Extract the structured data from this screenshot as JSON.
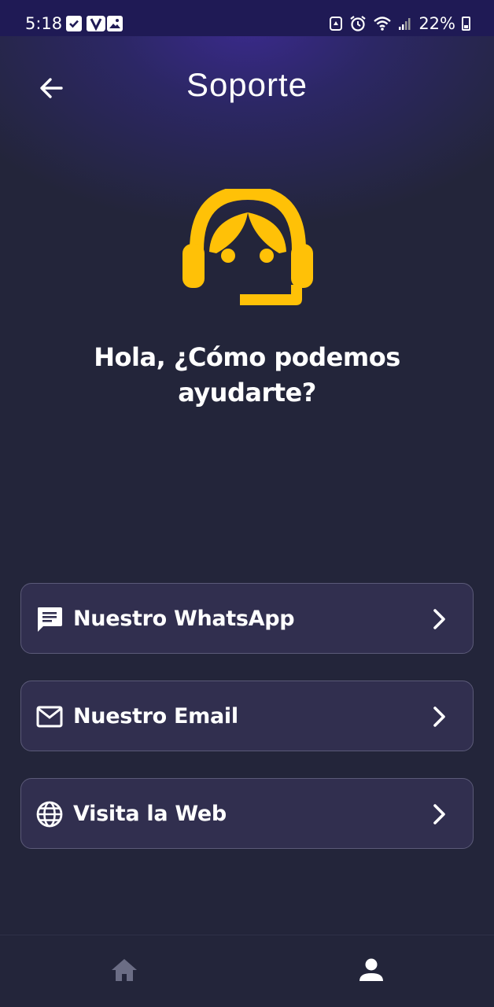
{
  "status_bar": {
    "time": "5:18",
    "battery": "22%",
    "left_icons": [
      "check-box-icon",
      "v-app-icon",
      "image-icon"
    ],
    "right_icons": [
      "recycle-icon",
      "alarm-icon",
      "wifi-icon",
      "signal-icon",
      "battery-icon"
    ]
  },
  "header": {
    "title": "Soporte",
    "back_icon": "arrow-left-icon"
  },
  "illustration": {
    "icon": "support-agent-icon",
    "color": "#ffc107"
  },
  "greeting": {
    "text": "Hola, ¿Cómo podemos ayudarte?"
  },
  "options": [
    {
      "label": "Nuestro WhatsApp",
      "icon": "chat-message-icon"
    },
    {
      "label": "Nuestro Email",
      "icon": "mail-icon"
    },
    {
      "label": "Visita la Web",
      "icon": "globe-icon"
    }
  ],
  "bottom_nav": {
    "items": [
      {
        "icon": "home-icon",
        "active": false
      },
      {
        "icon": "person-icon",
        "active": true
      }
    ]
  },
  "colors": {
    "background": "#23253a",
    "header_glow": "#3a2a8c",
    "card_background": "#312f4f",
    "card_border": "#5b5a78",
    "accent": "#ffc107",
    "inactive_nav": "#6b6d85"
  }
}
